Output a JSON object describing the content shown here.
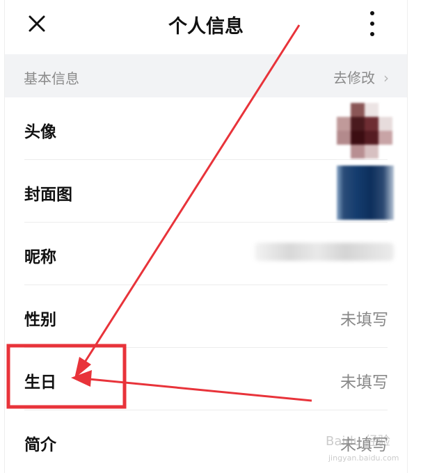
{
  "header": {
    "title": "个人信息",
    "close_icon": "close-icon",
    "more_icon": "more-vertical-icon"
  },
  "section": {
    "title": "基本信息",
    "edit_label": "去修改",
    "chevron": "›"
  },
  "rows": [
    {
      "label": "头像",
      "value": ""
    },
    {
      "label": "封面图",
      "value": ""
    },
    {
      "label": "昵称",
      "value": ""
    },
    {
      "label": "性别",
      "value": "未填写"
    },
    {
      "label": "生日",
      "value": "未填写"
    },
    {
      "label": "简介",
      "value": "未填写"
    }
  ],
  "watermark": {
    "text": "Baidu 经验",
    "sub": "jingyan.baidu.com"
  },
  "colors": {
    "annotation": "#e8333a",
    "section_bg": "#f2f3f5",
    "muted_text": "#888888"
  }
}
